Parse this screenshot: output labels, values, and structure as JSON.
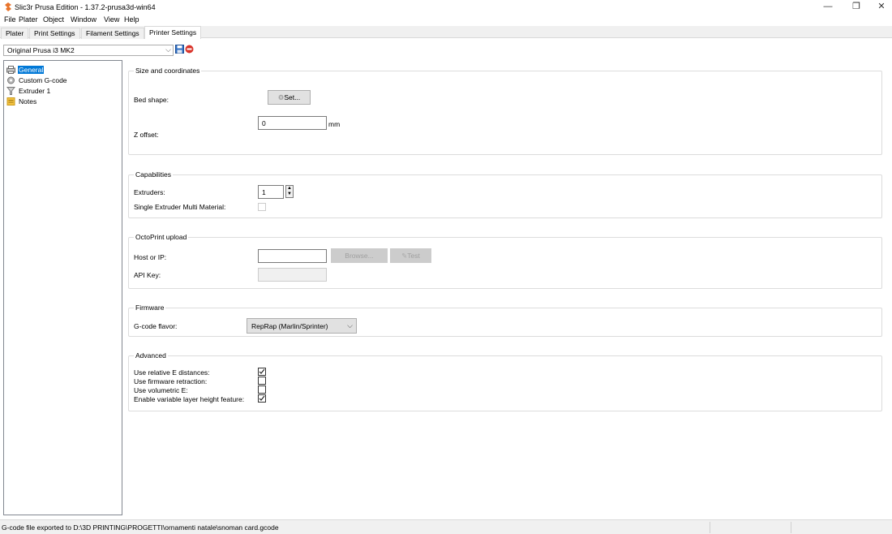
{
  "window": {
    "title": "Slic3r Prusa Edition - 1.37.2-prusa3d-win64",
    "minimize": "—",
    "restore": "❐",
    "close": "✕"
  },
  "menu": [
    "File",
    "Plater",
    "Object",
    "Window",
    "View",
    "Help"
  ],
  "tabs": [
    "Plater",
    "Print Settings",
    "Filament Settings",
    "Printer Settings"
  ],
  "active_tab": "Printer Settings",
  "preset": {
    "selected": "Original Prusa i3 MK2",
    "arrow": "⌵"
  },
  "tree": {
    "items": [
      {
        "label": "General",
        "icon": "printer-icon",
        "selected": true
      },
      {
        "label": "Custom G-code",
        "icon": "gear-icon",
        "selected": false
      },
      {
        "label": "Extruder 1",
        "icon": "funnel-icon",
        "selected": false
      },
      {
        "label": "Notes",
        "icon": "note-icon",
        "selected": false
      }
    ]
  },
  "groups": {
    "size": {
      "title": "Size and coordinates",
      "bed_shape_label": "Bed shape:",
      "bed_shape_button": "Set...",
      "z_offset_label": "Z offset:",
      "z_offset_value": "0",
      "z_offset_unit": "mm"
    },
    "capabilities": {
      "title": "Capabilities",
      "extruders_label": "Extruders:",
      "extruders_value": "1",
      "semm_label": "Single Extruder Multi Material:",
      "semm_checked": false
    },
    "octoprint": {
      "title": "OctoPrint upload",
      "host_label": "Host or IP:",
      "host_value": "",
      "browse_button": "Browse...",
      "test_button": "Test",
      "api_key_label": "API Key:",
      "api_key_value": ""
    },
    "firmware": {
      "title": "Firmware",
      "flavor_label": "G-code flavor:",
      "flavor_value": "RepRap (Marlin/Sprinter)",
      "flavor_arrow": "⌵"
    },
    "advanced": {
      "title": "Advanced",
      "items": [
        {
          "label": "Use relative E distances:",
          "checked": true
        },
        {
          "label": "Use firmware retraction:",
          "checked": false
        },
        {
          "label": "Use volumetric E:",
          "checked": false
        },
        {
          "label": "Enable variable layer height feature:",
          "checked": true
        }
      ]
    }
  },
  "status": {
    "message": "G-code file exported to D:\\3D PRINTING\\PROGETTI\\ornamenti natale\\snoman card.gcode"
  },
  "colors": {
    "selection": "#0078d7",
    "accent_orange": "#e8742c",
    "save_blue": "#2f6fc4",
    "delete_red": "#d9342b"
  }
}
